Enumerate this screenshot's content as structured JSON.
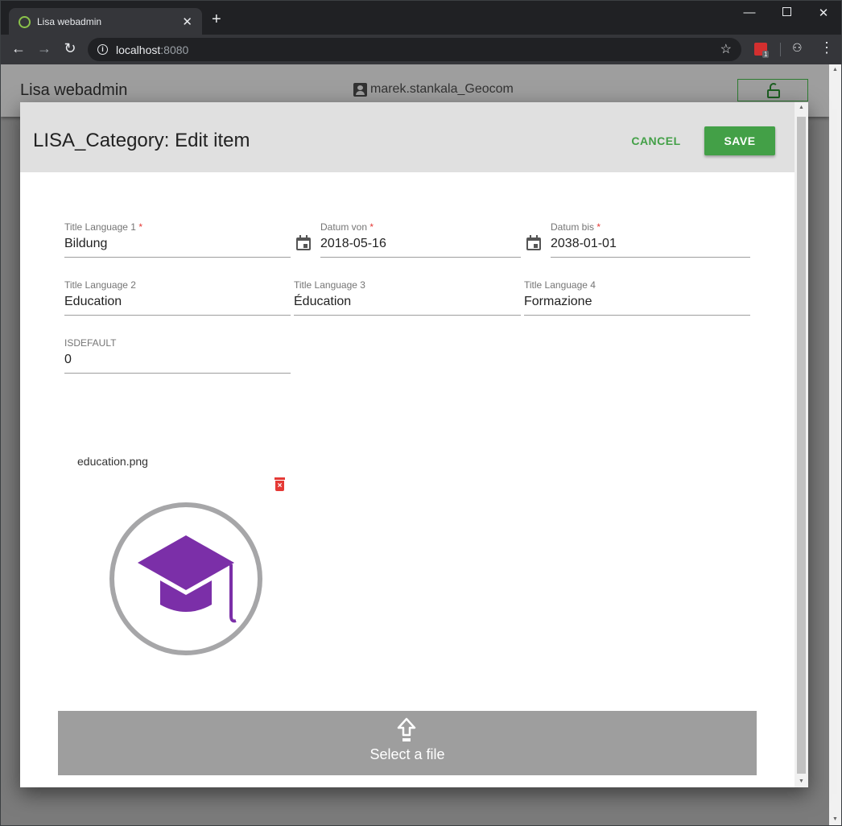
{
  "browser": {
    "tab_title": "Lisa webadmin",
    "tab_close": "✕",
    "new_tab": "+",
    "url_host": "localhost",
    "url_port": ":8080",
    "extension_badge": "1",
    "icons": [
      "favicon-ring-icon",
      "back-arrow-icon",
      "forward-arrow-icon",
      "reload-icon",
      "info-icon",
      "star-icon",
      "extension-icon",
      "incognito-icon",
      "menu-dots-icon"
    ]
  },
  "app": {
    "title": "Lisa webadmin",
    "user": "marek.stankala_Geocom",
    "lock_state": "unlocked"
  },
  "dialog": {
    "title": "LISA_Category: Edit item",
    "cancel_label": "CANCEL",
    "save_label": "SAVE",
    "fields": {
      "title_lang1": {
        "label": "Title Language 1",
        "required": "*",
        "value": "Bildung"
      },
      "datum_von": {
        "label": "Datum von",
        "required": "*",
        "value": "2018-05-16"
      },
      "datum_bis": {
        "label": "Datum bis",
        "required": "*",
        "value": "2038-01-01"
      },
      "title_lang2": {
        "label": "Title Language 2",
        "value": "Education"
      },
      "title_lang3": {
        "label": "Title Language 3",
        "value": "Éducation"
      },
      "title_lang4": {
        "label": "Title Language 4",
        "value": "Formazione"
      },
      "isdefault": {
        "label": "ISDEFAULT",
        "value": "0"
      }
    },
    "file": {
      "name": "education.png",
      "image_icon": "graduation-cap-icon"
    },
    "upload_label": "Select a file"
  },
  "colors": {
    "accent_green": "#43a047",
    "required_red": "#e53935",
    "cap_purple": "#7b2fa8",
    "app_bar": "#9e9e9e"
  }
}
